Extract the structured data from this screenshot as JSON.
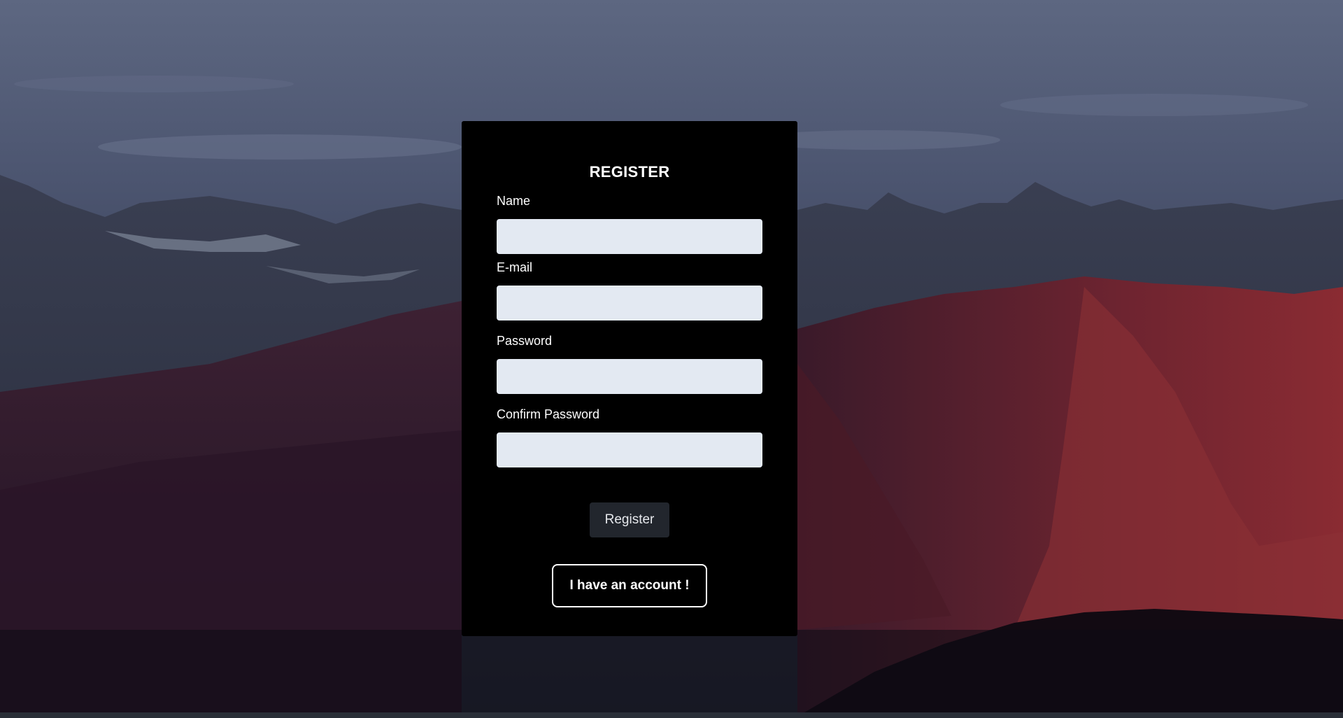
{
  "form": {
    "title": "REGISTER",
    "fields": [
      {
        "label": "Name",
        "value": "",
        "placeholder": ""
      },
      {
        "label": "E-mail",
        "value": "",
        "placeholder": ""
      },
      {
        "label": "Password",
        "value": "",
        "placeholder": ""
      },
      {
        "label": "Confirm Password",
        "value": "",
        "placeholder": ""
      }
    ],
    "register_label": "Register",
    "account_label": "I have an account !"
  },
  "colors": {
    "card_background": "#000000",
    "input_background": "#e3e9f2",
    "register_button": "#22262d",
    "text": "#ffffff"
  },
  "background": {
    "description_icon": "mountain-landscape-image"
  }
}
